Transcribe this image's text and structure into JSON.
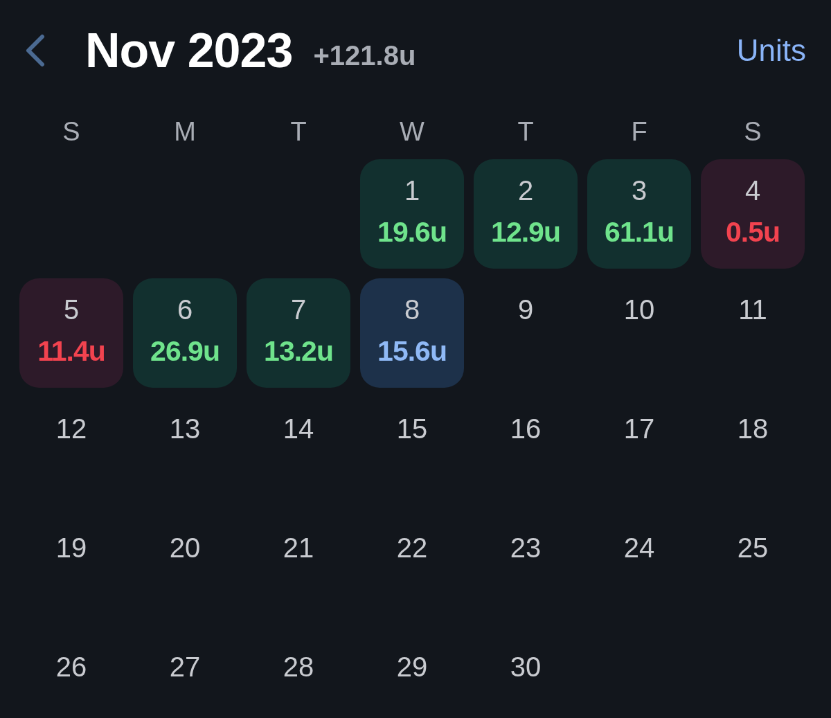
{
  "header": {
    "title": "Nov 2023",
    "total": "+121.8u",
    "units_button": "Units"
  },
  "weekdays": [
    "S",
    "M",
    "T",
    "W",
    "T",
    "F",
    "S"
  ],
  "weeks": [
    [
      {
        "day": "1",
        "value": "19.6u",
        "kind": "gain"
      },
      {
        "day": "2",
        "value": "12.9u",
        "kind": "gain"
      },
      {
        "day": "3",
        "value": "61.1u",
        "kind": "gain"
      },
      {
        "day": "4",
        "value": "0.5u",
        "kind": "loss"
      }
    ],
    [
      {
        "day": "5",
        "value": "11.4u",
        "kind": "loss"
      },
      {
        "day": "6",
        "value": "26.9u",
        "kind": "gain"
      },
      {
        "day": "7",
        "value": "13.2u",
        "kind": "gain"
      },
      {
        "day": "8",
        "value": "15.6u",
        "kind": "pending"
      },
      {
        "day": "9",
        "kind": "plain"
      },
      {
        "day": "10",
        "kind": "plain"
      },
      {
        "day": "11",
        "kind": "plain"
      }
    ],
    [
      {
        "day": "12",
        "kind": "plain"
      },
      {
        "day": "13",
        "kind": "plain"
      },
      {
        "day": "14",
        "kind": "plain"
      },
      {
        "day": "15",
        "kind": "plain"
      },
      {
        "day": "16",
        "kind": "plain"
      },
      {
        "day": "17",
        "kind": "plain"
      },
      {
        "day": "18",
        "kind": "plain"
      }
    ],
    [
      {
        "day": "19",
        "kind": "plain"
      },
      {
        "day": "20",
        "kind": "plain"
      },
      {
        "day": "21",
        "kind": "plain"
      },
      {
        "day": "22",
        "kind": "plain"
      },
      {
        "day": "23",
        "kind": "plain"
      },
      {
        "day": "24",
        "kind": "plain"
      },
      {
        "day": "25",
        "kind": "plain"
      }
    ],
    [
      {
        "day": "26",
        "kind": "plain"
      },
      {
        "day": "27",
        "kind": "plain"
      },
      {
        "day": "28",
        "kind": "plain"
      },
      {
        "day": "29",
        "kind": "plain"
      },
      {
        "day": "30",
        "kind": "plain"
      }
    ]
  ]
}
